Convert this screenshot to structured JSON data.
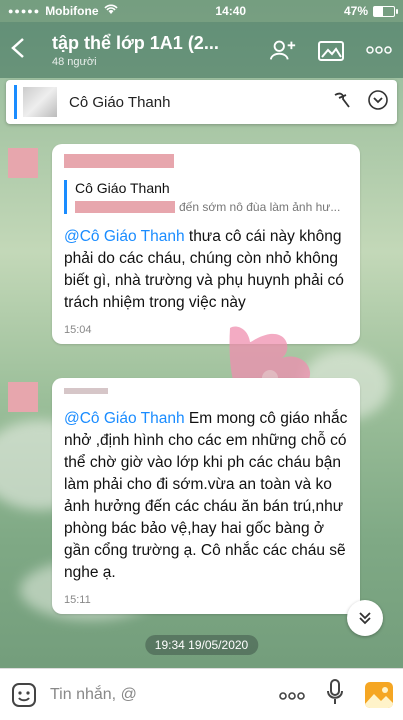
{
  "status_bar": {
    "carrier": "Mobifone",
    "time": "14:40",
    "battery": "47%",
    "battery_fraction": 0.47
  },
  "header": {
    "title": "tập thể lớp 1A1 (2...",
    "subtitle": "48 người",
    "icons": [
      "back-arrow",
      "add-member-icon",
      "gallery-icon",
      "more-icon"
    ]
  },
  "pinned": {
    "name": "Cô Giáo Thanh"
  },
  "messages": [
    {
      "quote_name": "Cô Giáo Thanh",
      "quote_text": "đến sớm nô đùa làm ảnh hư...",
      "mention": "@Cô Giáo Thanh",
      "text": " thưa cô cái này không phải do các cháu, chúng còn nhỏ không biết gì, nhà trường và phụ huynh phải có trách nhiệm trong việc này",
      "time": "15:04"
    },
    {
      "mention": "@Cô Giáo Thanh",
      "text": " Em mong cô giáo nhắc nhở ,định hình cho các em những chỗ có thể chờ giờ vào lớp khi ph các cháu bận làm phải cho đi sớm.vừa an toàn và ko ảnh hưởng đến các cháu ăn bán trú,như phòng bác bảo vệ,hay hai gốc bàng ở gần cổng trường ạ. Cô nhắc các cháu sẽ nghe ạ.",
      "time": "15:11"
    }
  ],
  "date_separator": "19:34 19/05/2020",
  "input": {
    "placeholder": "Tin nhắn, @"
  },
  "colors": {
    "accent": "#1a8cff",
    "redaction": "#e7a6ad",
    "header_bg": "#3c6e5a"
  }
}
